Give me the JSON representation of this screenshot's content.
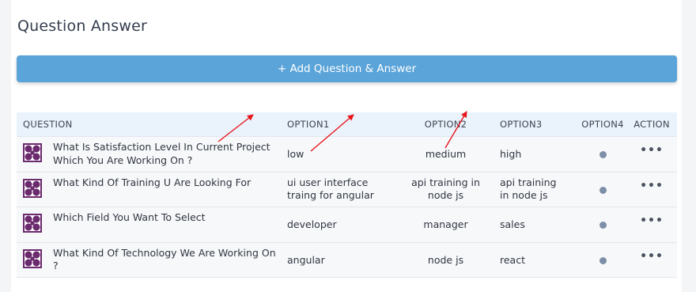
{
  "page": {
    "title": "Question Answer"
  },
  "toolbar": {
    "add_label": "+ Add Question & Answer"
  },
  "table": {
    "headers": {
      "question": "QUESTION",
      "option1": "OPTION1",
      "option2": "OPTION2",
      "option3": "OPTION3",
      "option4": "OPTION4",
      "action": "ACTION"
    },
    "rows": [
      {
        "question": "What Is Satisfaction Level In Current Project Which You Are Working On ?",
        "option1": "low",
        "option2": "medium",
        "option3": "high",
        "action": "•••"
      },
      {
        "question": "What Kind Of Training U Are Looking For",
        "option1": "ui user interface traing for angular",
        "option2": "api training in node js",
        "option3": "api training in node js",
        "action": "•••"
      },
      {
        "question": "Which Field You Want To Select",
        "option1": "developer",
        "option2": "manager",
        "option3": "sales",
        "action": "•••"
      },
      {
        "question": "What Kind Of Technology We Are Working On ?",
        "option1": "angular",
        "option2": "node js",
        "option3": "react",
        "action": "•••"
      }
    ]
  },
  "colors": {
    "accent": "#5ba4d9",
    "header_bg": "#eaf3fb",
    "annotation_arrow": "#e8141b"
  }
}
